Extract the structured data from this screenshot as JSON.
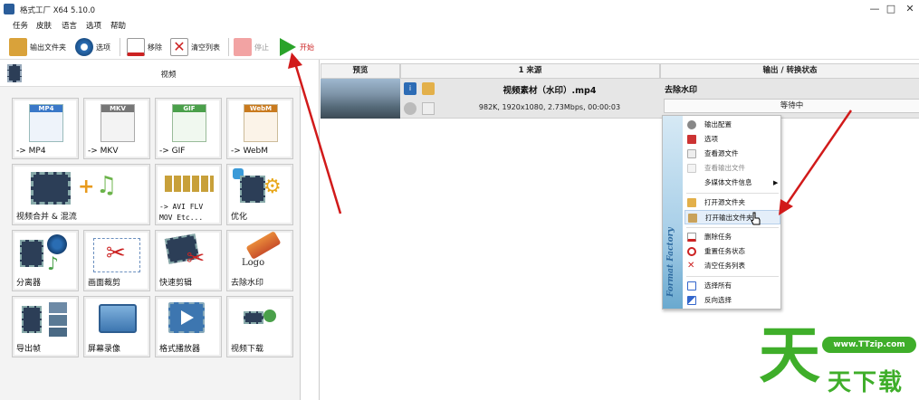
{
  "window": {
    "title": "格式工厂 X64 5.10.0",
    "minimize": "—",
    "maximize": "□",
    "close": "✕"
  },
  "menu": [
    "任务",
    "皮肤",
    "语言",
    "选项",
    "帮助"
  ],
  "toolbar": {
    "output_folder": "输出文件夹",
    "options": "选项",
    "remove": "移除",
    "clear_list": "清空列表",
    "stop": "停止",
    "start": "开始"
  },
  "left": {
    "section_title": "视频",
    "tiles": [
      {
        "label": "-> MP4",
        "badge": "MP4",
        "badge_color": "#3a78c8"
      },
      {
        "label": "-> MKV",
        "badge": "MKV",
        "badge_color": "#777777"
      },
      {
        "label": "-> GIF",
        "badge": "GIF",
        "badge_color": "#4aa04a"
      },
      {
        "label": "-> WebM",
        "badge": "WebM",
        "badge_color": "#c97a1e"
      },
      {
        "label": "视频合并 & 混流"
      },
      {
        "label": "-> AVI FLV",
        "label2": "MOV Etc..."
      },
      {
        "label": "优化"
      },
      {
        "label": "分离器"
      },
      {
        "label": "画面裁剪"
      },
      {
        "label": "快速剪辑"
      },
      {
        "label": "去除水印",
        "art_text": "Logo"
      },
      {
        "label": "导出帧"
      },
      {
        "label": "屏幕录像"
      },
      {
        "label": "格式播放器"
      },
      {
        "label": "视频下载"
      }
    ]
  },
  "table": {
    "headers": {
      "preview": "预览",
      "source": "1 来源",
      "output": "输出 / 转换状态"
    },
    "row": {
      "filename": "视频素材（水印）.mp4",
      "details": "982K, 1920x1080, 2.73Mbps, 00:00:03",
      "task": "去除水印",
      "status": "等待中"
    }
  },
  "context_menu": {
    "brand": "Format Factory",
    "items": [
      "输出配置",
      "选项",
      "查看源文件",
      "查看输出文件",
      "多媒体文件信息",
      "打开源文件夹",
      "打开输出文件夹",
      "删除任务",
      "重置任务状态",
      "清空任务列表",
      "选择所有",
      "反向选择"
    ]
  },
  "watermark": {
    "char": "天",
    "url": "www.TTzip.com",
    "text": "天下载"
  },
  "colors": {
    "accent_red": "#d11a1a",
    "start_green": "#2aa32a",
    "watermark_green": "#3fae2a"
  }
}
